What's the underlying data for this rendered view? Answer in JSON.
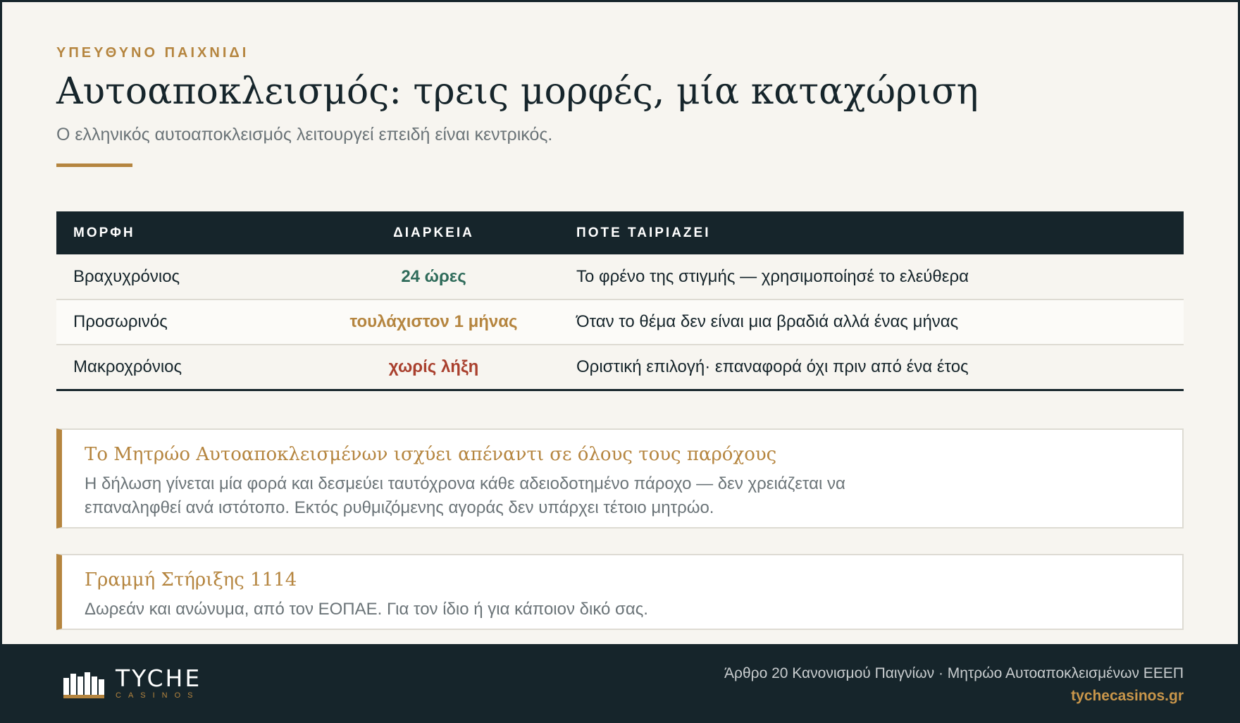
{
  "header": {
    "eyebrow": "ΥΠΕΥΘΥΝΟ ΠΑΙΧΝΙΔΙ",
    "title": "Αυτοαποκλεισμός: τρεις μορφές, μία καταχώριση",
    "subtitle": "Ο ελληνικός αυτοαποκλεισμός λειτουργεί επειδή είναι κεντρικός."
  },
  "table": {
    "columns": [
      "ΜΟΡΦΗ",
      "ΔΙΑΡΚΕΙΑ",
      "ΠΟΤΕ ΤΑΙΡΙΑΖΕΙ"
    ],
    "rows": [
      {
        "form": "Βραχυχρόνιος",
        "duration": "24 ώρες",
        "duration_color": "#2f6b5a",
        "fit": "Το φρένο της στιγμής — χρησιμοποίησέ το ελεύθερα"
      },
      {
        "form": "Προσωρινός",
        "duration": "τουλάχιστον 1 μήνας",
        "duration_color": "#b5853f",
        "fit": "Όταν το θέμα δεν είναι μια βραδιά αλλά ένας μήνας"
      },
      {
        "form": "Μακροχρόνιος",
        "duration": "χωρίς λήξη",
        "duration_color": "#a9402e",
        "fit": "Οριστική επιλογή· επαναφορά όχι πριν από ένα έτος"
      }
    ]
  },
  "callouts": [
    {
      "title": "Το Μητρώο Αυτοαποκλεισμένων ισχύει απέναντι σε όλους τους παρόχους",
      "body": "Η δήλωση γίνεται μία φορά και δεσμεύει ταυτόχρονα κάθε αδειοδοτημένο πάροχο — δεν χρειάζεται να επαναληφθεί ανά ιστότοπο. Εκτός ρυθμιζόμενης αγοράς δεν υπάρχει τέτοιο μητρώο."
    },
    {
      "title": "Γραμμή Στήριξης 1114",
      "body": "Δωρεάν και ανώνυμα, από τον ΕΟΠΑΕ. Για τον ίδιο ή για κάποιον δικό σας."
    }
  ],
  "footer": {
    "logo_name": "TYCHE",
    "logo_sub": "CASINOS",
    "source": "Άρθρο 20 Κανονισμού Παιγνίων · Μητρώο Αυτοαποκλεισμένων ΕΕΕΠ",
    "url": "tychecasinos.gr"
  },
  "colors": {
    "accent": "#b5853f",
    "dark": "#16252b",
    "background": "#f7f5f0"
  }
}
